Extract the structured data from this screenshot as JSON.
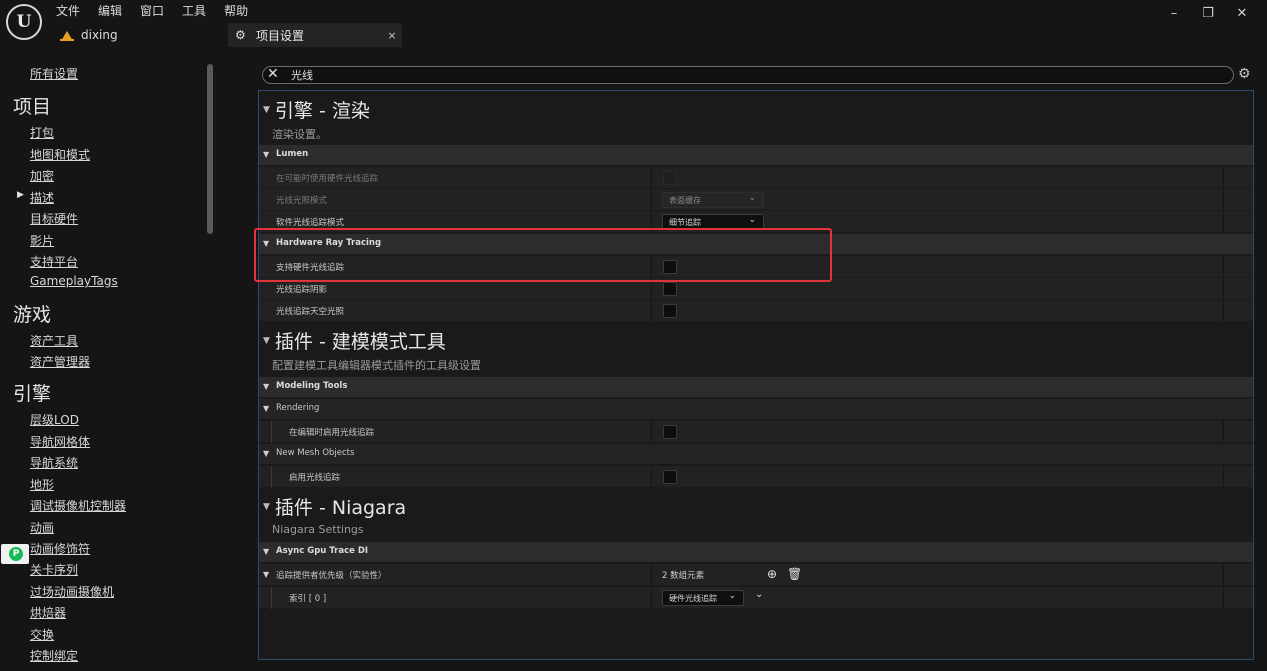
{
  "menu": [
    "文件",
    "编辑",
    "窗口",
    "工具",
    "帮助"
  ],
  "project": {
    "name": "dixing"
  },
  "tab": {
    "label": "项目设置",
    "close": "×"
  },
  "window_controls": {
    "minimize": "–",
    "restore": "❐",
    "close": "✕"
  },
  "nav": {
    "all_settings": "所有设置",
    "sections": [
      {
        "title": "项目",
        "items": [
          "打包",
          "地图和模式",
          "加密",
          "描述",
          "目标硬件",
          "影片",
          "支持平台",
          "GameplayTags"
        ]
      },
      {
        "title": "游戏",
        "items": [
          "资产工具",
          "资产管理器"
        ]
      },
      {
        "title": "引擎",
        "items": [
          "层级LOD",
          "导航网格体",
          "导航系统",
          "地形",
          "调试摄像机控制器",
          "动画",
          "动画修饰符",
          "关卡序列",
          "过场动画摄像机",
          "烘焙器",
          "交换",
          "控制绑定"
        ]
      }
    ],
    "expanded_item": "描述"
  },
  "search": {
    "value": "光线",
    "clear": "✕"
  },
  "categories": [
    {
      "title": "引擎 - 渲染",
      "desc": "渲染设置。"
    },
    {
      "title": "插件 - 建模模式工具",
      "desc": "配置建模工具编辑器模式插件的工具级设置"
    },
    {
      "title": "插件 - Niagara",
      "desc": "Niagara Settings"
    }
  ],
  "groups": {
    "lumen": "Lumen",
    "hw_rt": "Hardware Ray Tracing",
    "modeling_tools": "Modeling Tools",
    "rendering": "Rendering",
    "new_mesh": "New Mesh Objects",
    "async_gpu": "Async Gpu Trace DI"
  },
  "props": {
    "hw_when_possible": "在可能时使用硬件光线追踪",
    "rt_lighting_mode": "光线光照模式",
    "rt_lighting_mode_value": "表面缓存",
    "sw_rt_mode": "软件光线追踪模式",
    "sw_rt_mode_value": "细节追踪",
    "support_hw_rt": "支持硬件光线追踪",
    "rt_shadows": "光线追踪阴影",
    "rt_skylight": "光线追踪天空光照",
    "enable_rt_in_editor": "在编辑时启用光线追踪",
    "enable_rt": "启用光线追踪",
    "trace_provider_priority": "追踪提供者优先级（实验性）",
    "trace_provider_count": "2 数组元素",
    "index0": "索引 [ 0 ]",
    "index0_value": "硬件光线追踪"
  },
  "highlight_color": "#e0343a"
}
